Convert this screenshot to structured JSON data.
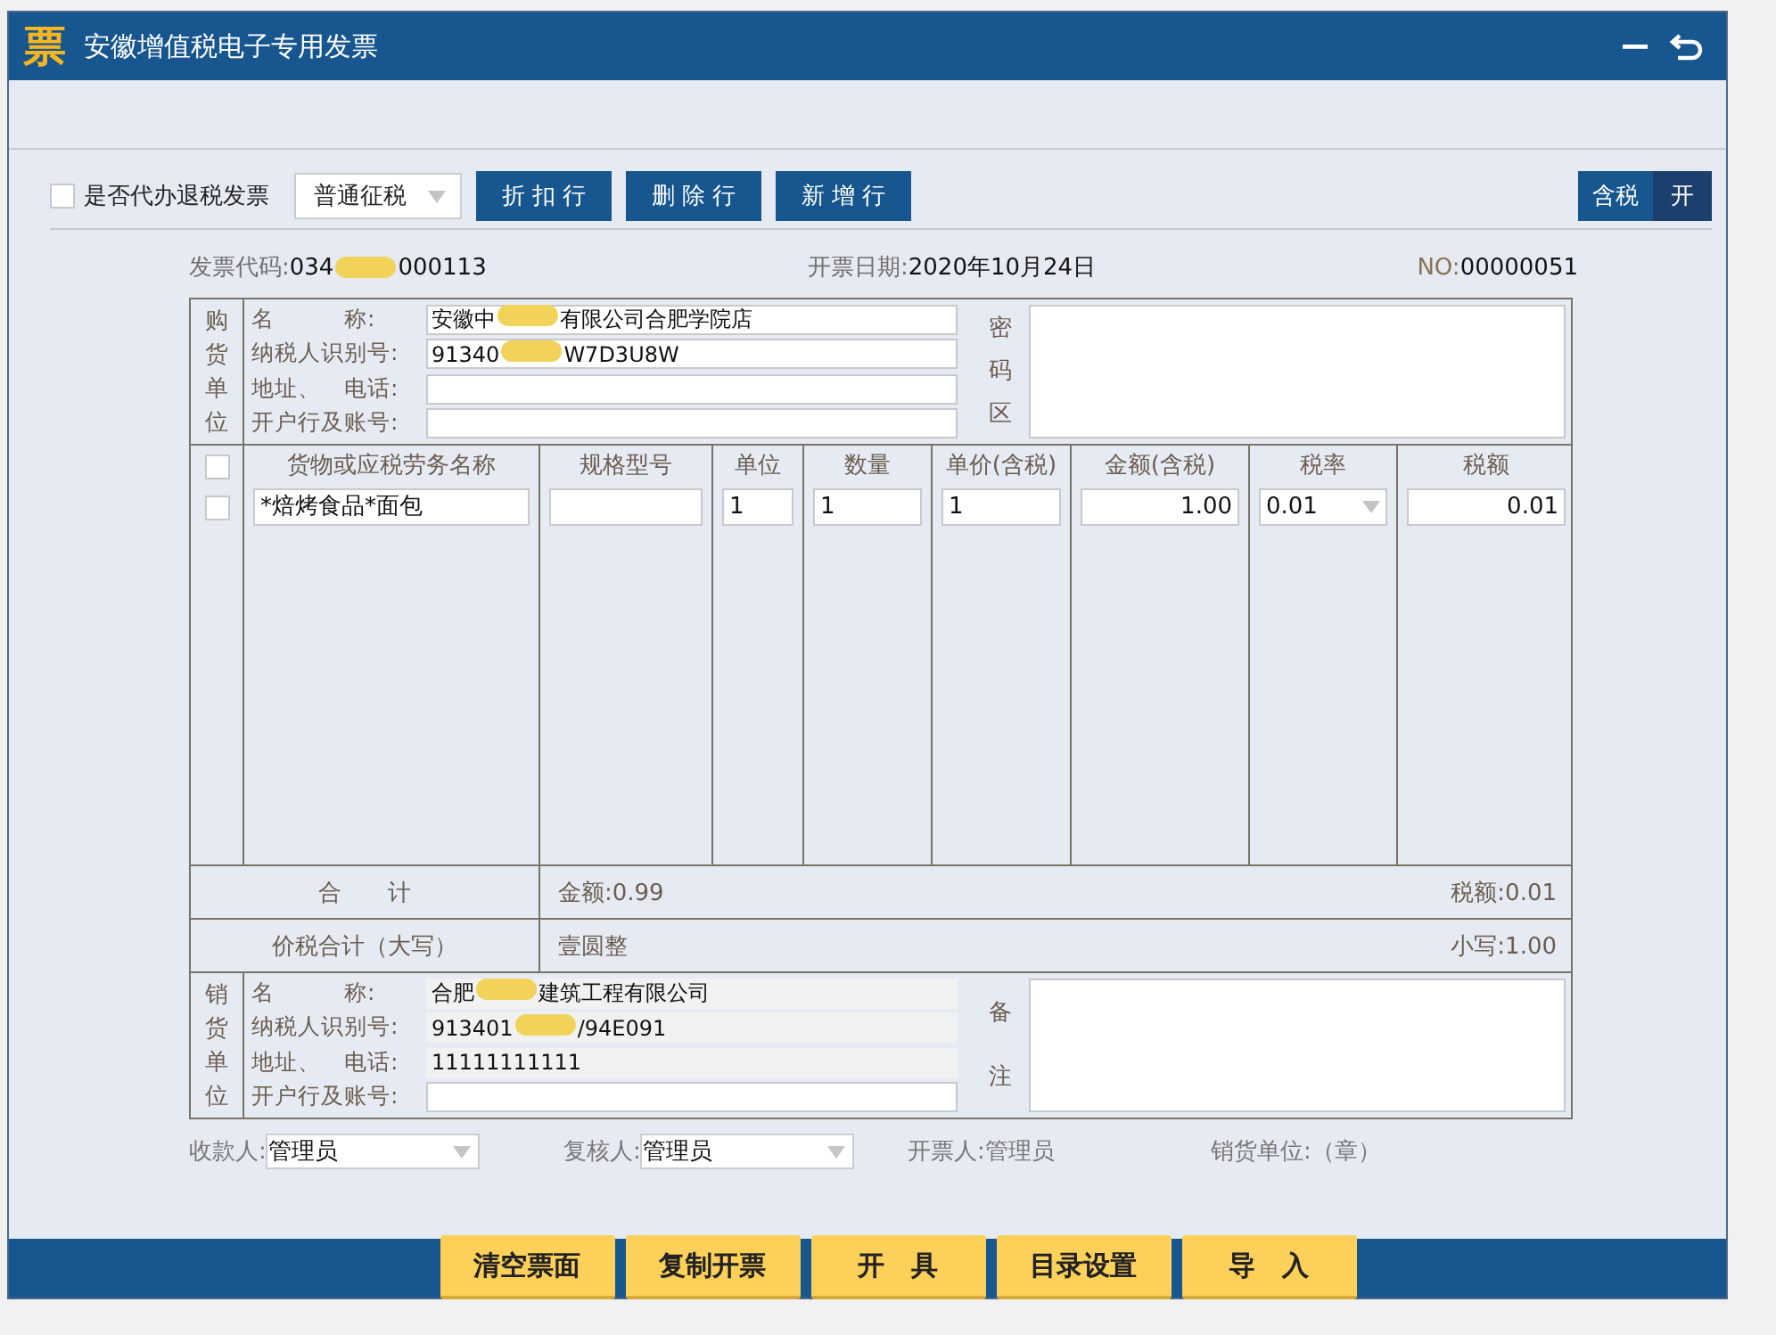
{
  "window": {
    "title": "安徽增值税电子专用发票",
    "logo": "票"
  },
  "toolbar": {
    "refund_checkbox": {
      "label": "是否代办退税发票",
      "checked": false
    },
    "tax_type": "普通征税",
    "buttons": [
      "折 扣 行",
      "删 除 行",
      "新 增 行"
    ],
    "tax_toggle": {
      "label": "含税",
      "state": "开",
      "on": true
    }
  },
  "header": {
    "code_label": "发票代码:",
    "code": "034",
    "code_after_redaction": "000113",
    "date_label": "开票日期:",
    "date": "2020年10月24日",
    "number_label": "NO:",
    "number": "00000051"
  },
  "buyer": {
    "side_label": "购货单位",
    "fields": [
      {
        "label": "名　　　称:",
        "value": "安徽中",
        "after_redaction": "有限公司合肥学院店"
      },
      {
        "label": "纳税人识别号:",
        "value": "91340",
        "after_redaction": "W7D3U8W"
      },
      {
        "label": "地址、　电话:"
      },
      {
        "label": "开户行及账号:"
      }
    ],
    "secret_label": "密码区"
  },
  "items": {
    "select_all_checked": false,
    "columns": [
      "货物或应税劳务名称",
      "规格型号",
      "单位",
      "数量",
      "单价(含税)",
      "金额(含税)",
      "税率",
      "税额"
    ],
    "rows": [
      {
        "selected": false,
        "name": "*焙烤食品*面包",
        "unit": "1",
        "quantity": "1",
        "price": "1",
        "amount": "1.00",
        "rate": "0.01",
        "tax": "0.01"
      }
    ]
  },
  "totals": {
    "label": "合　　计",
    "amount": "金额:0.99",
    "tax": "税额:0.01"
  },
  "grand_total": {
    "label": "价税合计（大写）",
    "words": "壹圆整",
    "figures": "小写:1.00"
  },
  "seller": {
    "side_label": "销货单位",
    "fields": [
      {
        "label": "名　　　称:",
        "value": "合肥",
        "after_redaction": "建筑工程有限公司",
        "readonly": true
      },
      {
        "label": "纳税人识别号:",
        "value": "913401",
        "after_redaction": "/94E091",
        "readonly": true
      },
      {
        "label": "地址、　电话:",
        "value": "11111111111",
        "readonly": true
      },
      {
        "label": "开户行及账号:",
        "readonly": false
      }
    ],
    "remarks_label": "备注"
  },
  "signatures": [
    {
      "kind": "dropdown",
      "label": "收款人:",
      "value": "管理员"
    },
    {
      "kind": "dropdown",
      "label": "复核人:",
      "value": "管理员"
    },
    {
      "kind": "text",
      "label": "开票人:",
      "value": "管理员"
    },
    {
      "kind": "text",
      "label": "销货单位:",
      "value": "（章）"
    }
  ],
  "actions": [
    "清空票面",
    "复制开票",
    "开　具",
    "目录设置",
    "导　入"
  ]
}
